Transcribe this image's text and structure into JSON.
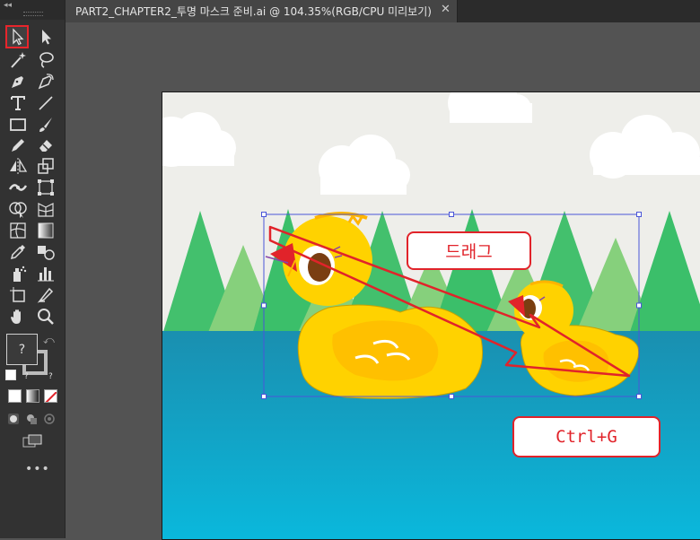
{
  "tab": {
    "title": "PART2_CHAPTER2_투명 마스크 준비.ai @ 104.35%(RGB/CPU 미리보기)",
    "close": "✕"
  },
  "toolbar": {
    "collapse": "◂◂",
    "fill_stroke": {
      "fill_label": "?",
      "q1": "?",
      "q2": "?"
    },
    "more": "•••",
    "tools": [
      "selection-tool-icon",
      "direct-selection-tool-icon",
      "magic-wand-tool-icon",
      "lasso-tool-icon",
      "pen-tool-icon",
      "curvature-tool-icon",
      "type-tool-icon",
      "line-segment-tool-icon",
      "rectangle-tool-icon",
      "paintbrush-tool-icon",
      "pencil-tool-icon",
      "eraser-tool-icon",
      "reflect-tool-icon",
      "scale-tool-icon",
      "width-tool-icon",
      "free-transform-tool-icon",
      "shape-builder-tool-icon",
      "perspective-grid-tool-icon",
      "mesh-tool-icon",
      "gradient-tool-icon",
      "eyedropper-tool-icon",
      "blend-tool-icon",
      "symbol-sprayer-tool-icon",
      "column-graph-tool-icon",
      "artboard-tool-icon",
      "slice-tool-icon",
      "hand-tool-icon",
      "zoom-tool-icon"
    ],
    "selected_tool": "selection-tool-icon"
  },
  "callouts": {
    "drag": "드래그",
    "group": "Ctrl+G"
  },
  "colors": {
    "accent_red": "#e1232a",
    "water": "#1aa5c9",
    "sky": "#eeeeea",
    "tree": "#3bbf6a",
    "duck": "#ffd200"
  }
}
